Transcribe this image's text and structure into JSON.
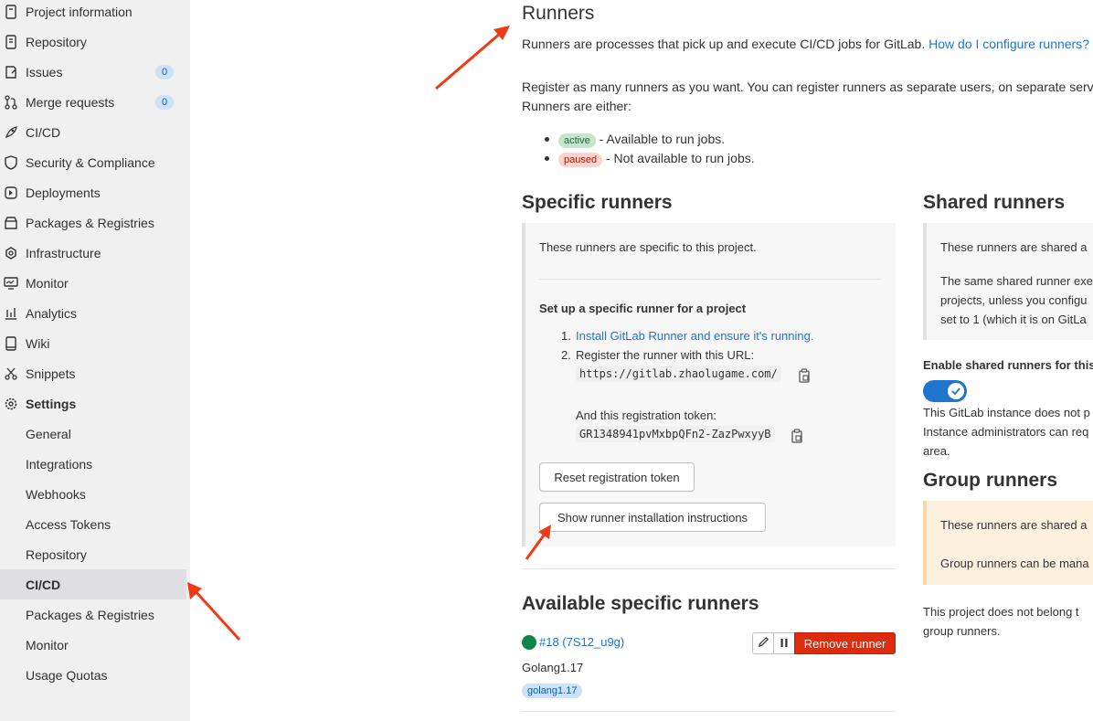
{
  "sidebar": {
    "items": [
      {
        "label": "Project information",
        "icon": "info-icon"
      },
      {
        "label": "Repository",
        "icon": "doc-icon"
      },
      {
        "label": "Issues",
        "icon": "issues-icon",
        "badge": "0"
      },
      {
        "label": "Merge requests",
        "icon": "merge-icon",
        "badge": "0"
      },
      {
        "label": "CI/CD",
        "icon": "rocket-icon"
      },
      {
        "label": "Security & Compliance",
        "icon": "shield-icon"
      },
      {
        "label": "Deployments",
        "icon": "deploy-icon"
      },
      {
        "label": "Packages & Registries",
        "icon": "package-icon"
      },
      {
        "label": "Infrastructure",
        "icon": "cloud-gear-icon"
      },
      {
        "label": "Monitor",
        "icon": "monitor-icon"
      },
      {
        "label": "Analytics",
        "icon": "chart-icon"
      },
      {
        "label": "Wiki",
        "icon": "book-icon"
      },
      {
        "label": "Snippets",
        "icon": "scissors-icon"
      },
      {
        "label": "Settings",
        "icon": "gear-icon"
      }
    ],
    "settings_sub": [
      "General",
      "Integrations",
      "Webhooks",
      "Access Tokens",
      "Repository",
      "CI/CD",
      "Packages & Registries",
      "Monitor",
      "Usage Quotas"
    ],
    "active_sub": "CI/CD"
  },
  "runners": {
    "title": "Runners",
    "intro": "Runners are processes that pick up and execute CI/CD jobs for GitLab.",
    "intro_link": "How do I configure runners?",
    "register_line1": "Register as many runners as you want. You can register runners as separate users, on separate servers,",
    "register_line2": "Runners are either:",
    "status_active": "active",
    "status_active_desc": "- Available to run jobs.",
    "status_paused": "paused",
    "status_paused_desc": "- Not available to run jobs."
  },
  "specific": {
    "title": "Specific runners",
    "desc": "These runners are specific to this project.",
    "setup_title": "Set up a specific runner for a project",
    "step1_num": "1.",
    "step1": "Install GitLab Runner and ensure it's running.",
    "step2_num": "2.",
    "step2": "Register the runner with this URL:",
    "url": "https://gitlab.zhaolugame.com/",
    "token_label": "And this registration token:",
    "token": "GR1348941pvMxbpQFn2-ZazPwxyyB",
    "reset_button": "Reset registration token",
    "show_button": "Show runner installation instructions"
  },
  "available": {
    "title": "Available specific runners",
    "runner_id": "#18 (7S12_u9g)",
    "runner_desc": "Golang1.17",
    "runner_tag": "golang1.17",
    "remove_button": "Remove runner"
  },
  "shared": {
    "title": "Shared runners",
    "p1": "These runners are shared a",
    "p2a": "The same shared runner exe",
    "p2b": "projects, unless you configu",
    "p2c": "set to 1 (which it is on GitLa",
    "enable_label": "Enable shared runners for this",
    "note1": "This GitLab instance does not p",
    "note2": "Instance administrators can req",
    "note3": "area."
  },
  "group": {
    "title": "Group runners",
    "p1": "These runners are shared a",
    "p2": "Group runners can be mana",
    "note1": "This project does not belong t",
    "note2": "group runners."
  },
  "colors": {
    "accent": "#1f75cb",
    "danger": "#dd2b0e",
    "arrow": "#f03a17"
  }
}
